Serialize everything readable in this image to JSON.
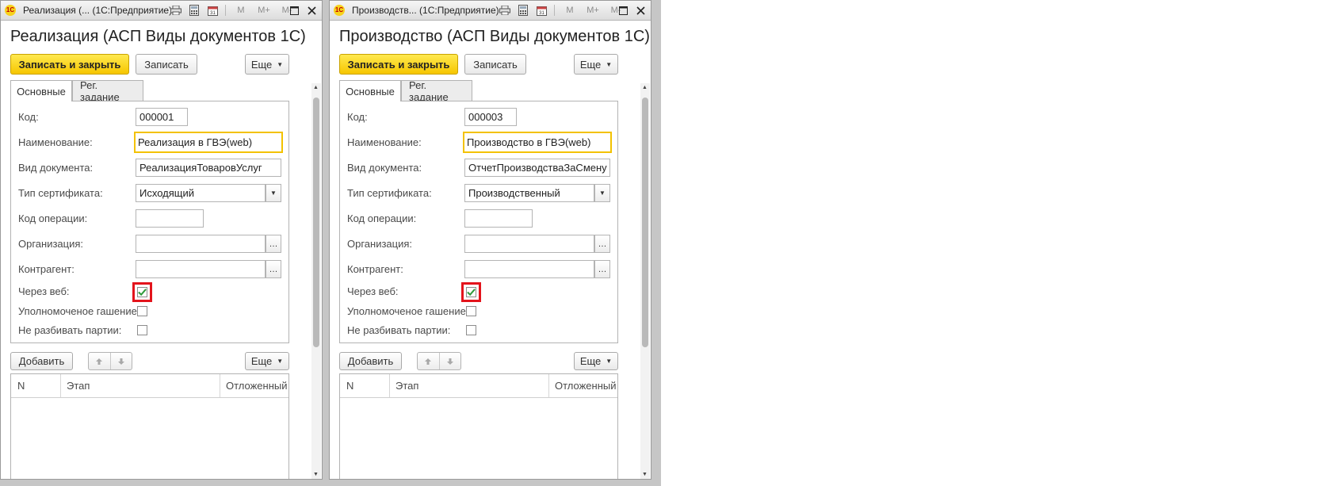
{
  "windows": [
    {
      "titlebar": "Реализация (... (1С:Предприятие)",
      "form_title": "Реализация (АСП Виды документов 1С)",
      "buttons": {
        "save_close": "Записать и закрыть",
        "save": "Записать",
        "more": "Еще"
      },
      "tabs": [
        "Основные",
        "Рег. задание"
      ],
      "fields": {
        "kod_label": "Код:",
        "kod_value": "000001",
        "naim_label": "Наименование:",
        "naim_value": "Реализация в ГВЭ(web)",
        "vid_label": "Вид документа:",
        "vid_value": "РеализацияТоваровУслуг",
        "tip_label": "Тип сертификата:",
        "tip_value": "Исходящий",
        "kodop_label": "Код операции:",
        "kodop_value": "",
        "org_label": "Организация:",
        "org_value": "",
        "kontr_label": "Контрагент:",
        "kontr_value": ""
      },
      "checks": {
        "web_label": "Через веб:",
        "web_checked": true,
        "upoln_label": "Уполномоченое гашение:",
        "upoln_checked": false,
        "nerazb_label": "Не разбивать партии:",
        "nerazb_checked": false
      },
      "table_toolbar": {
        "add": "Добавить",
        "more": "Еще"
      },
      "table_columns": [
        "N",
        "Этап",
        "Отложенный"
      ]
    },
    {
      "titlebar": "Производств... (1С:Предприятие)",
      "form_title": "Производство (АСП Виды документов 1С)",
      "buttons": {
        "save_close": "Записать и закрыть",
        "save": "Записать",
        "more": "Еще"
      },
      "tabs": [
        "Основные",
        "Рег. задание"
      ],
      "fields": {
        "kod_label": "Код:",
        "kod_value": "000003",
        "naim_label": "Наименование:",
        "naim_value": "Производство в ГВЭ(web)",
        "vid_label": "Вид документа:",
        "vid_value": "ОтчетПроизводстваЗаСмену",
        "tip_label": "Тип сертификата:",
        "tip_value": "Производственный",
        "kodop_label": "Код операции:",
        "kodop_value": "",
        "org_label": "Организация:",
        "org_value": "",
        "kontr_label": "Контрагент:",
        "kontr_value": ""
      },
      "checks": {
        "web_label": "Через веб:",
        "web_checked": true,
        "upoln_label": "Уполномоченое гашение:",
        "upoln_checked": false,
        "nerazb_label": "Не разбивать партии:",
        "nerazb_checked": false
      },
      "table_toolbar": {
        "add": "Добавить",
        "more": "Еще"
      },
      "table_columns": [
        "N",
        "Этап",
        "Отложенный"
      ]
    }
  ],
  "toolbar_text": {
    "m": "M",
    "mplus": "M+",
    "mminus": "M-"
  },
  "icons": {
    "app": "1c-logo-icon",
    "print": "printer-icon",
    "calc": "calculator-icon",
    "calendar": "calendar-icon",
    "maximize": "maximize-icon",
    "close": "close-icon",
    "dropdown": "chevron-down-icon",
    "select": "ellipsis-icon",
    "up": "arrow-up-icon",
    "down": "arrow-down-icon",
    "check": "checkmark-icon"
  },
  "colors": {
    "accent_yellow": "#f6c600",
    "highlight_red": "#e3141c",
    "check_green": "#2e9a3a",
    "focus_border": "#f3c200"
  }
}
